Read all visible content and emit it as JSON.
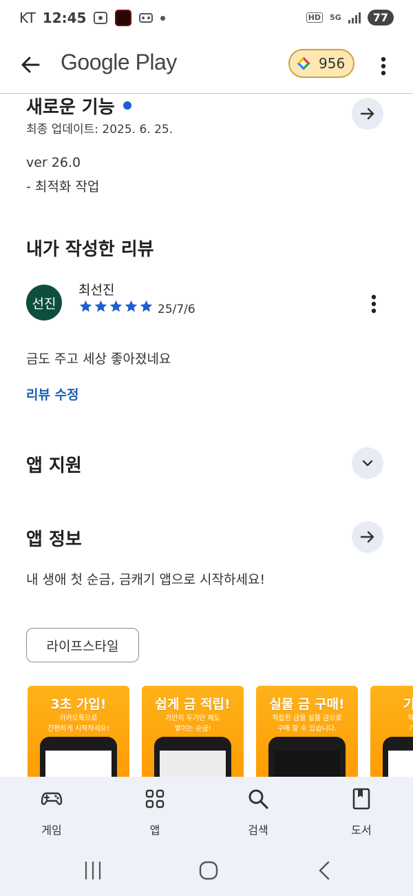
{
  "status_bar": {
    "carrier": "KT",
    "time": "12:45",
    "hd_label": "HD",
    "network_label": "5G",
    "battery": "77"
  },
  "app_bar": {
    "title": "Google Play",
    "points": "956"
  },
  "whats_new": {
    "title": "새로운 기능",
    "updated": "최종 업데이트: 2025. 6. 25.",
    "version": "ver 26.0",
    "notes": "- 최적화 작업"
  },
  "my_review": {
    "title": "내가 작성한 리뷰",
    "avatar_text": "선진",
    "reviewer": "최선진",
    "rating": 5,
    "date": "25/7/6",
    "text": "금도 주고 세상 좋아졌네요",
    "edit_label": "리뷰 수정"
  },
  "app_support": {
    "title": "앱 지원"
  },
  "app_info": {
    "title": "앱 정보",
    "description": "내 생애 첫 순금, 금캐기 앱으로 시작하세요!",
    "category_chip": "라이프스타일"
  },
  "screenshots": [
    {
      "title": "3초 가입!",
      "subtitle1": "카카오톡으로",
      "subtitle2": "간편하게 시작하세요!"
    },
    {
      "title": "쉽게 금 적립!",
      "subtitle1": "가만히 두기만 해도",
      "subtitle2": "쌓이는 순금!"
    },
    {
      "title": "실물 금 구매!",
      "subtitle1": "적립한 금을 실물 금으로",
      "subtitle2": "구매 할 수 있습니다."
    },
    {
      "title": "기프티",
      "subtitle1": "적립한 금",
      "subtitle2": "기프티콘"
    }
  ],
  "bottom_nav": {
    "games": "게임",
    "apps": "앱",
    "search": "검색",
    "books": "도서"
  },
  "colors": {
    "accent_blue": "#1a5fb4",
    "avatar_green": "#0d4f3c",
    "star_blue": "#1a5fd0",
    "chip_gold": "#fde7b3",
    "screenshot_orange": "#ff9a00",
    "nav_bg": "#eef1f8"
  }
}
